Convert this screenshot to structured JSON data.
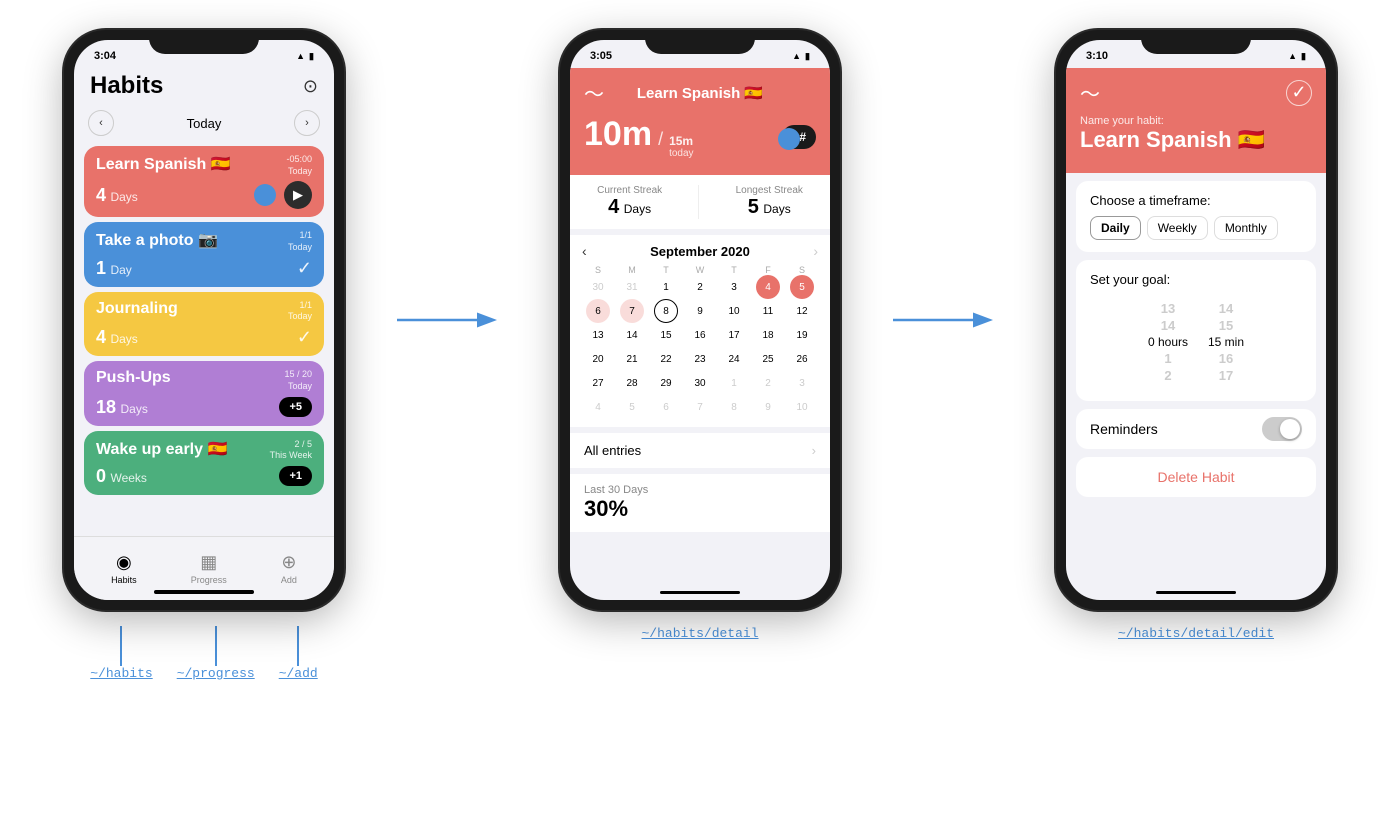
{
  "page": {
    "background": "#ffffff"
  },
  "phone1": {
    "status_time": "3:04",
    "title": "Habits",
    "nav_date": "Today",
    "settings_icon": "⊙",
    "habits": [
      {
        "name": "Learn Spanish 🇪🇸",
        "meta_top": "-05:00",
        "meta_bottom": "Today",
        "count": "4",
        "unit": "Days",
        "action": "▶",
        "color": "#e8726a",
        "action_type": "arrow"
      },
      {
        "name": "Take a photo 📷",
        "meta_top": "1/1",
        "meta_bottom": "Today",
        "count": "1",
        "unit": "Day",
        "action": "✓",
        "color": "#4a90d9",
        "action_type": "check"
      },
      {
        "name": "Journaling",
        "meta_top": "1/1",
        "meta_bottom": "Today",
        "count": "4",
        "unit": "Days",
        "action": "✓",
        "color": "#f5c842",
        "action_type": "check"
      },
      {
        "name": "Push-Ups",
        "meta_top": "15 / 20",
        "meta_bottom": "Today",
        "count": "18",
        "unit": "Days",
        "action": "+5",
        "color": "#b07ed4",
        "action_type": "plus"
      },
      {
        "name": "Wake up early 🇪🇸",
        "meta_top": "2 / 5",
        "meta_bottom": "This Week",
        "count": "0",
        "unit": "Weeks",
        "action": "+1",
        "color": "#4caf7d",
        "action_type": "plus"
      }
    ],
    "tabs": [
      {
        "label": "Habits",
        "icon": "●",
        "active": true
      },
      {
        "label": "Progress",
        "icon": "▦",
        "active": false
      },
      {
        "label": "Add",
        "icon": "⊕",
        "active": false
      }
    ]
  },
  "phone2": {
    "status_time": "3:05",
    "title": "Learn Spanish 🇪🇸",
    "back_icon": "~",
    "time_big": "10m",
    "time_slash": "/",
    "time_small_top": "15m",
    "time_small_bottom": "today",
    "plus_btn": "+#",
    "current_streak_label": "Current Streak",
    "current_streak_value": "4",
    "current_streak_unit": "Days",
    "longest_streak_label": "Longest Streak",
    "longest_streak_value": "5",
    "longest_streak_unit": "Days",
    "calendar_month": "September 2020",
    "calendar_weeks": [
      [
        "30",
        "31",
        "1",
        "2",
        "3",
        "4",
        "5"
      ],
      [
        "6",
        "7",
        "8",
        "9",
        "10",
        "11",
        "12"
      ],
      [
        "13",
        "14",
        "15",
        "16",
        "17",
        "18",
        "19"
      ],
      [
        "20",
        "21",
        "22",
        "23",
        "24",
        "25",
        "26"
      ],
      [
        "27",
        "28",
        "29",
        "30",
        "1",
        "2",
        "3"
      ],
      [
        "4",
        "5",
        "6",
        "7",
        "8",
        "9",
        "10"
      ]
    ],
    "highlighted_days": [
      "4",
      "5"
    ],
    "light_days": [
      "6",
      "7"
    ],
    "today_day": "8",
    "muted_days_start": [
      "30",
      "31"
    ],
    "muted_days_end": [
      "1",
      "2",
      "3",
      "4",
      "5",
      "6",
      "7",
      "8",
      "9",
      "10"
    ],
    "all_entries_label": "All entries",
    "last30_label": "Last 30 Days",
    "last30_value": "30%"
  },
  "phone3": {
    "status_time": "3:10",
    "back_icon": "~",
    "check_icon": "✓",
    "name_label": "Name your habit:",
    "habit_name": "Learn Spanish 🇪🇸",
    "timeframe_label": "Choose a timeframe:",
    "timeframe_options": [
      "Daily",
      "Weekly",
      "Monthly"
    ],
    "goal_label": "Set your goal:",
    "picker_rows": [
      {
        "top": "13",
        "mid": "14",
        "selected": "0 hours",
        "bottom1": "1",
        "bottom2": "2"
      },
      {
        "top": "14",
        "mid": "15 min",
        "selected": "15",
        "bottom1": "16",
        "bottom2": "17"
      }
    ],
    "hours_label": "0 hours",
    "min_label": "15 min",
    "reminders_label": "Reminders",
    "delete_label": "Delete Habit"
  },
  "arrow1": {
    "color": "#4a90d9"
  },
  "routes_phone1": {
    "habits": "~/habits",
    "progress": "~/progress",
    "add": "~/add"
  },
  "routes_phone2": {
    "detail": "~/habits/detail"
  },
  "routes_phone3": {
    "edit": "~/habits/detail/edit"
  }
}
